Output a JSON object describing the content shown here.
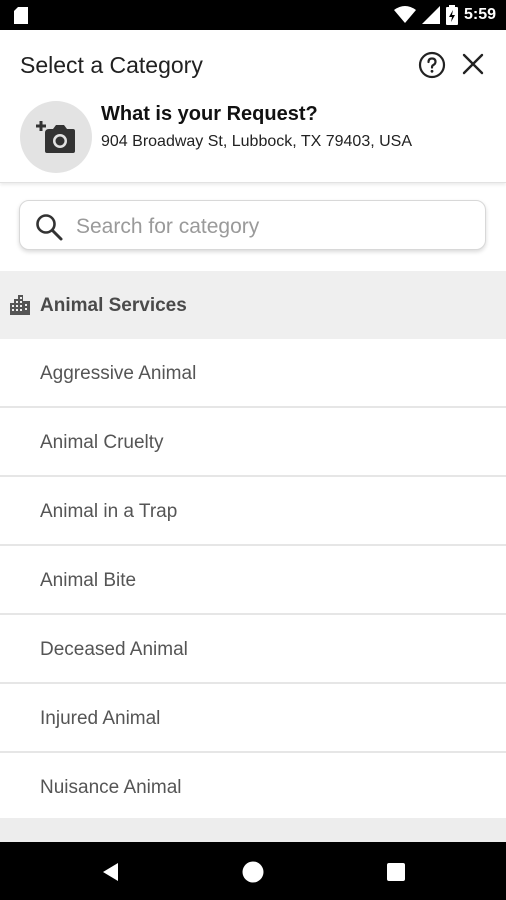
{
  "status_bar": {
    "time": "5:59",
    "icons": [
      "sd-card-icon",
      "wifi-icon",
      "signal-icon",
      "battery-icon"
    ]
  },
  "header": {
    "title": "Select a Category",
    "help_icon": "help-circle-icon",
    "close_icon": "close-icon"
  },
  "request": {
    "title": "What is your Request?",
    "address": "904 Broadway St, Lubbock, TX 79403, USA",
    "photo_icon": "add-photo-icon"
  },
  "search": {
    "placeholder": "Search for category",
    "value": ""
  },
  "section": {
    "label": "Animal Services",
    "icon": "city-buildings-icon"
  },
  "items": [
    {
      "label": "Aggressive Animal"
    },
    {
      "label": "Animal Cruelty"
    },
    {
      "label": "Animal in a Trap"
    },
    {
      "label": "Animal Bite"
    },
    {
      "label": "Deceased Animal"
    },
    {
      "label": "Injured Animal"
    },
    {
      "label": "Nuisance Animal"
    }
  ],
  "nav_bar": {
    "buttons": [
      "back-icon",
      "home-icon",
      "recents-icon"
    ]
  },
  "colors": {
    "section_bg": "#efefef",
    "divider": "#e6e6e6",
    "avatar_bg": "#e3e3e3"
  }
}
